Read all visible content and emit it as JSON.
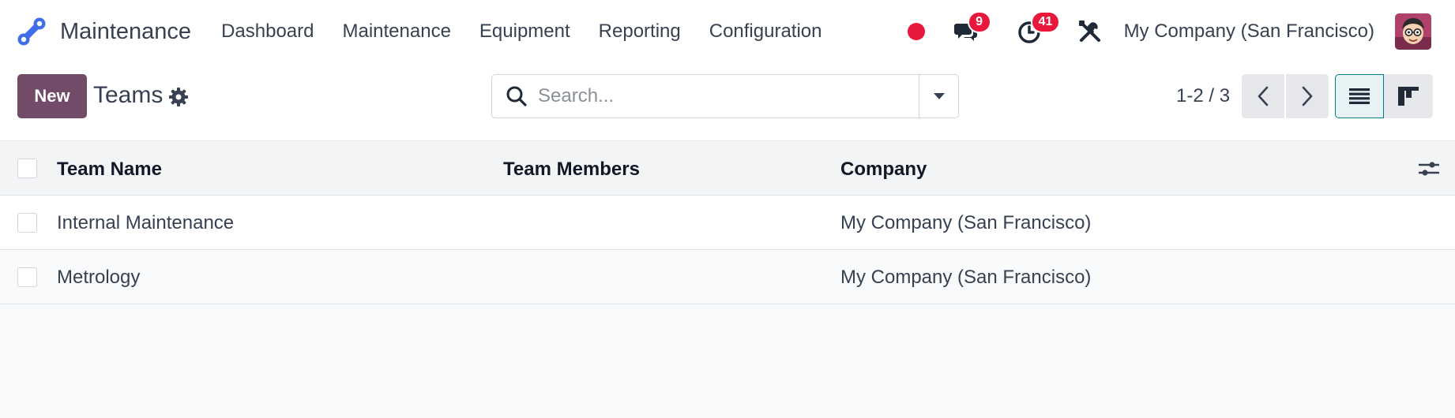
{
  "navbar": {
    "app_name": "Maintenance",
    "menu": [
      {
        "label": "Dashboard"
      },
      {
        "label": "Maintenance"
      },
      {
        "label": "Equipment"
      },
      {
        "label": "Reporting"
      },
      {
        "label": "Configuration"
      }
    ],
    "messages_count": "9",
    "activities_count": "41",
    "company": "My Company (San Francisco)",
    "colors": {
      "accent": "#714b67",
      "badge": "#e8173c",
      "brand_icon": "#3f6ee6"
    }
  },
  "control_panel": {
    "new_label": "New",
    "title": "Teams",
    "search_placeholder": "Search...",
    "pager": "1-2 / 3"
  },
  "list": {
    "columns": [
      "Team Name",
      "Team Members",
      "Company"
    ],
    "rows": [
      {
        "name": "Internal Maintenance",
        "members": "",
        "company": "My Company (San Francisco)"
      },
      {
        "name": "Metrology",
        "members": "",
        "company": "My Company (San Francisco)"
      }
    ]
  }
}
